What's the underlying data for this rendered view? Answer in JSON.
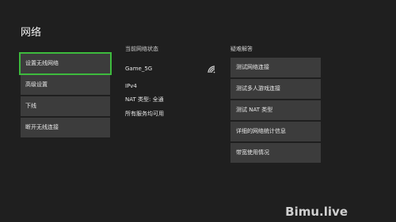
{
  "page": {
    "title": "网络"
  },
  "menu": {
    "items": [
      {
        "label": "设置无线网络"
      },
      {
        "label": "高级设置"
      },
      {
        "label": "下线"
      },
      {
        "label": "断开无线连接"
      }
    ]
  },
  "status": {
    "heading": "当前网络状态",
    "network_name": "Game_5G",
    "network_icon": "wifi-icon",
    "ip_version": "IPv4",
    "nat_type": "NAT 类型: 全通",
    "services": "所有服务均可用"
  },
  "troubleshoot": {
    "heading": "疑难解答",
    "items": [
      {
        "label": "测试网络连接"
      },
      {
        "label": "测试多人游戏连接"
      },
      {
        "label": "测试 NAT 类型"
      },
      {
        "label": "详细的网络统计信息"
      },
      {
        "label": "带宽使用情况"
      }
    ]
  },
  "watermark": "Bimu.live",
  "colors": {
    "focus": "#3dbb3d",
    "tile": "#3c3c3c",
    "background": "#1f1f1f"
  }
}
